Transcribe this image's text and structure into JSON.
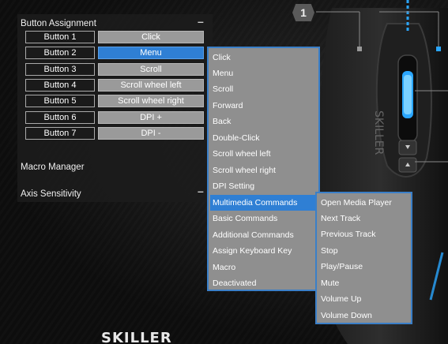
{
  "panel": {
    "button_assignment_title": "Button Assignment",
    "collapse_symbol": "–",
    "macro_manager_title": "Macro Manager",
    "axis_sensitivity_title": "Axis Sensitivity"
  },
  "assignments": [
    {
      "button": "Button 1",
      "value": "Click"
    },
    {
      "button": "Button 2",
      "value": "Menu"
    },
    {
      "button": "Button 3",
      "value": "Scroll"
    },
    {
      "button": "Button 4",
      "value": "Scroll wheel left"
    },
    {
      "button": "Button 5",
      "value": "Scroll wheel right"
    },
    {
      "button": "Button 6",
      "value": "DPI +"
    },
    {
      "button": "Button 7",
      "value": "DPI -"
    }
  ],
  "menu": {
    "items": [
      "Click",
      "Menu",
      "Scroll",
      "Forward",
      "Back",
      "Double-Click",
      "Scroll wheel left",
      "Scroll wheel right",
      "DPI Setting",
      "Multimedia Commands",
      "Basic Commands",
      "Additional Commands",
      "Assign Keyboard Key",
      "Macro",
      "Deactivated"
    ],
    "highlighted": "Multimedia Commands"
  },
  "submenu": {
    "items": [
      "Open Media Player",
      "Next Track",
      "Previous Track",
      "Stop",
      "Play/Pause",
      "Mute",
      "Volume Up",
      "Volume Down"
    ]
  },
  "mouse": {
    "callout_number": "1",
    "brand_text": "SKILLER",
    "accent_color": "#2aa6ff"
  },
  "footer": {
    "logo_text": "SKILLER"
  },
  "colors": {
    "accent": "#2f7fd4",
    "menu_border": "#3a7fc8",
    "menu_bg": "#8f8f8f"
  }
}
